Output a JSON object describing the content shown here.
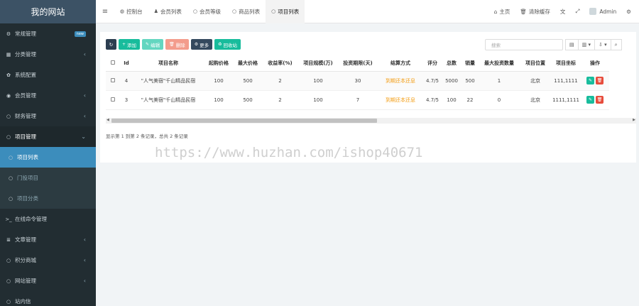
{
  "sidebar": {
    "brand": "我的网站",
    "items": [
      {
        "icon": "cogs-icon",
        "glyph": "⚙",
        "label": "常规管理",
        "badge": "new"
      },
      {
        "icon": "category-icon",
        "glyph": "▦",
        "label": "分类管理",
        "arrow": "‹"
      },
      {
        "icon": "settings-icon",
        "glyph": "✿",
        "label": "系统配置"
      },
      {
        "icon": "user-circle-icon",
        "glyph": "◉",
        "label": "会员管理",
        "arrow": "‹"
      },
      {
        "icon": "circle-icon",
        "glyph": "○",
        "label": "财务管理",
        "arrow": "‹"
      },
      {
        "icon": "circle-icon",
        "glyph": "○",
        "label": "项目管理",
        "arrow": "⌄"
      },
      {
        "icon": "circle-icon",
        "glyph": "○",
        "label": "项目列表"
      },
      {
        "icon": "circle-icon",
        "glyph": "○",
        "label": "门投项目"
      },
      {
        "icon": "circle-icon",
        "glyph": "○",
        "label": "项目分类"
      },
      {
        "icon": "terminal-icon",
        "glyph": ">_",
        "label": "在线命令管理"
      },
      {
        "icon": "list-icon",
        "glyph": "≣",
        "label": "文章管理",
        "arrow": "‹"
      },
      {
        "icon": "circle-icon",
        "glyph": "○",
        "label": "积分商城",
        "arrow": "‹"
      },
      {
        "icon": "circle-icon",
        "glyph": "○",
        "label": "网站管理",
        "arrow": "‹"
      },
      {
        "icon": "circle-icon",
        "glyph": "○",
        "label": "站内信"
      }
    ]
  },
  "topbar": {
    "tabs": [
      {
        "icon": "dashboard-icon",
        "glyph": "◍",
        "label": "控制台"
      },
      {
        "icon": "user-icon",
        "glyph": "♟",
        "label": "会员列表"
      },
      {
        "icon": "circle-icon",
        "glyph": "○",
        "label": "会员等级"
      },
      {
        "icon": "circle-icon",
        "glyph": "○",
        "label": "商品列表"
      },
      {
        "icon": "circle-icon",
        "glyph": "○",
        "label": "项目列表"
      }
    ],
    "home_label": "主页",
    "clear_cache_label": "清除缓存",
    "admin_label": "Admin"
  },
  "toolbar": {
    "add": "添加",
    "edit": "编辑",
    "delete": "删除",
    "more": "更多",
    "recycle": "回收站",
    "search_placeholder": "搜索"
  },
  "table": {
    "columns": [
      "Id",
      "项目名称",
      "起购价格",
      "最大价格",
      "收益率(%)",
      "项目规模(万)",
      "投资期限(天)",
      "结算方式",
      "评分",
      "总数",
      "销量",
      "最大投资数量",
      "项目位置",
      "项目坐标",
      "操作"
    ],
    "rows": [
      [
        "4",
        "\"人气美宿\"千山精品民宿",
        "100",
        "500",
        "2",
        "100",
        "30",
        "到期还本还息",
        "4.7/5",
        "5000",
        "500",
        "1",
        "北京",
        "111,1111"
      ],
      [
        "3",
        "\"人气美宿\"千山精品民宿",
        "100",
        "500",
        "2",
        "100",
        "7",
        "到期还本还息",
        "4.7/5",
        "100",
        "22",
        "0",
        "北京",
        "1111,1111"
      ]
    ]
  },
  "pageinfo": "显示第 1 到第 2 条记录，总共 2 条记录",
  "watermark": "https://www.huzhan.com/ishop40671",
  "colors": {
    "sidebar_bg": "#222d32",
    "brand_bg": "#3c5265",
    "active": "#3c8dbc",
    "green": "#18bc9c",
    "red": "#e74c3c",
    "orange": "#f39c12"
  }
}
